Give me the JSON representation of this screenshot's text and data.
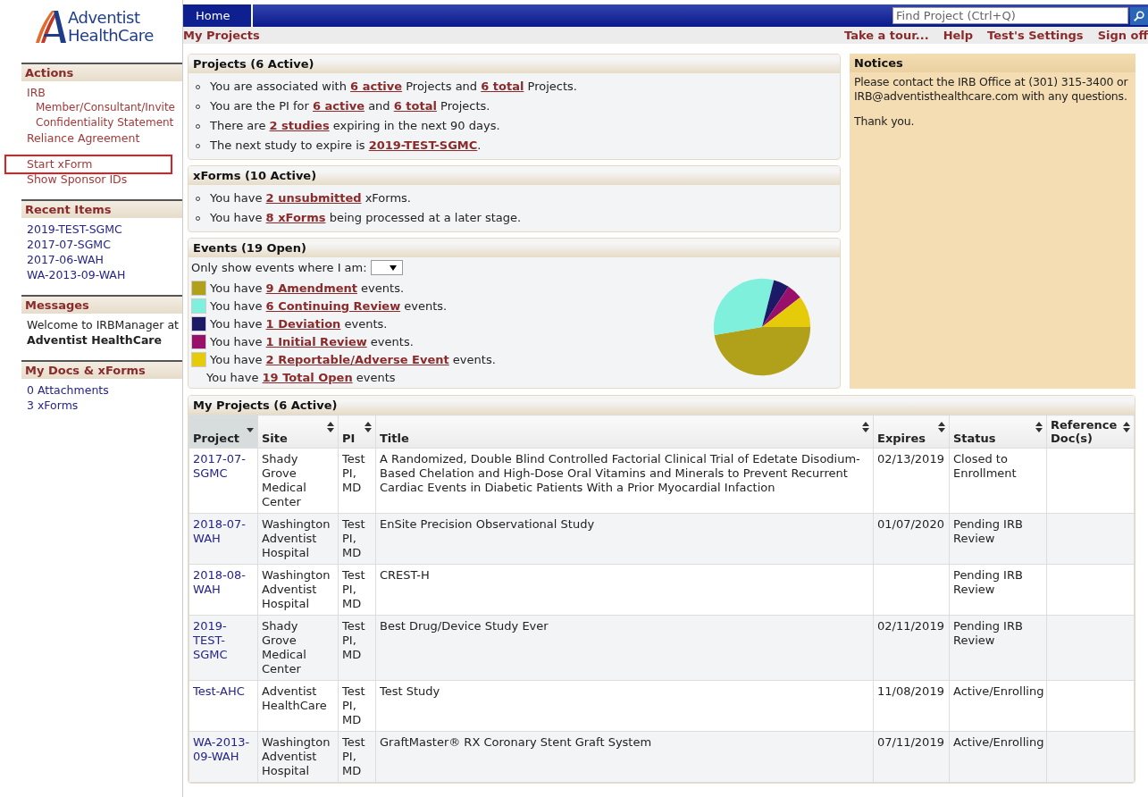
{
  "logo": {
    "line1": "Adventist",
    "line2": "HealthCare"
  },
  "top_bar": {
    "tabs": [
      {
        "label": "Home",
        "selected": true
      }
    ],
    "search": {
      "placeholder": "Find Project (Ctrl+Q)"
    }
  },
  "sub_bar": {
    "title": "My Projects",
    "links": [
      "Take a tour...",
      "Help",
      "Test's Settings",
      "Sign off"
    ]
  },
  "sidebar": [
    {
      "title": "Actions",
      "groups": [
        [
          {
            "kind": "action",
            "text": "IRB",
            "highlighted": false,
            "children": [
              {
                "text": "Member/Consultant/Invite Confidentiality Statement"
              }
            ]
          },
          {
            "kind": "action",
            "text": "Reliance Agreement",
            "highlighted": false
          }
        ],
        [
          {
            "kind": "action",
            "text": "Start xForm",
            "highlighted": true
          },
          {
            "kind": "action",
            "text": "Show Sponsor IDs",
            "highlighted": false
          }
        ]
      ]
    },
    {
      "title": "Recent Items",
      "groups": [
        [
          {
            "kind": "recent",
            "text": "2019-TEST-SGMC"
          },
          {
            "kind": "recent",
            "text": "2017-07-SGMC"
          },
          {
            "kind": "recent",
            "text": "2017-06-WAH"
          },
          {
            "kind": "recent",
            "text": "WA-2013-09-WAH"
          }
        ]
      ]
    },
    {
      "title": "Messages",
      "groups": [
        [
          {
            "kind": "message",
            "text": "Welcome to IRBManager at **Adventist HealthCare**"
          }
        ]
      ]
    },
    {
      "title": "My Docs & xForms",
      "groups": [
        [
          {
            "kind": "recent",
            "text": "0 Attachments"
          },
          {
            "kind": "recent",
            "text": "3 xForms"
          }
        ]
      ]
    }
  ],
  "projects": {
    "title": "Projects (6 Active)",
    "lines": [
      [
        {
          "kind": "text",
          "text": "You are associated with "
        },
        {
          "kind": "link",
          "text": "6 active"
        },
        {
          "kind": "text",
          "text": " Projects and "
        },
        {
          "kind": "link",
          "text": "6 total"
        },
        {
          "kind": "text",
          "text": " Projects."
        }
      ],
      [
        {
          "kind": "text",
          "text": "You are the PI for "
        },
        {
          "kind": "link",
          "text": "6 active"
        },
        {
          "kind": "text",
          "text": " and "
        },
        {
          "kind": "link",
          "text": "6 total"
        },
        {
          "kind": "text",
          "text": " Projects."
        }
      ],
      [
        {
          "kind": "text",
          "text": "There are "
        },
        {
          "kind": "link",
          "text": "2 studies"
        },
        {
          "kind": "text",
          "text": " expiring in the next 90 days."
        }
      ],
      [
        {
          "kind": "text",
          "text": "The next study to expire is "
        },
        {
          "kind": "link",
          "text": "2019-TEST-SGMC"
        },
        {
          "kind": "text",
          "text": "."
        }
      ]
    ]
  },
  "xforms": {
    "title": "xForms (10 Active)",
    "lines": [
      [
        {
          "kind": "text",
          "text": "You have "
        },
        {
          "kind": "link",
          "text": "2 unsubmitted"
        },
        {
          "kind": "text",
          "text": " xForms."
        }
      ],
      [
        {
          "kind": "text",
          "text": "You have "
        },
        {
          "kind": "link",
          "text": "8 xForms"
        },
        {
          "kind": "text",
          "text": " being processed at a later stage."
        }
      ]
    ]
  },
  "events": {
    "title": "Events (19 Open)",
    "filter_label": "Only show events where I am:",
    "items": [
      {
        "color": "#b1a11a",
        "parts": [
          {
            "kind": "text",
            "text": "You have "
          },
          {
            "kind": "link",
            "text": "9 Amendment"
          },
          {
            "kind": "text",
            "text": " events."
          }
        ]
      },
      {
        "color": "#7ff0dc",
        "parts": [
          {
            "kind": "text",
            "text": "You have "
          },
          {
            "kind": "link",
            "text": "6 Continuing Review"
          },
          {
            "kind": "text",
            "text": " events."
          }
        ]
      },
      {
        "color": "#1c1a66",
        "parts": [
          {
            "kind": "text",
            "text": "You have "
          },
          {
            "kind": "link",
            "text": "1 Deviation"
          },
          {
            "kind": "text",
            "text": " events."
          }
        ]
      },
      {
        "color": "#99106a",
        "parts": [
          {
            "kind": "text",
            "text": "You have "
          },
          {
            "kind": "link",
            "text": "1 Initial Review"
          },
          {
            "kind": "text",
            "text": " events."
          }
        ]
      },
      {
        "color": "#e6cb0a",
        "parts": [
          {
            "kind": "text",
            "text": "You have "
          },
          {
            "kind": "link",
            "text": "2 Reportable/Adverse Event"
          },
          {
            "kind": "text",
            "text": " events."
          }
        ]
      }
    ],
    "total": [
      {
        "kind": "text",
        "text": "You have "
      },
      {
        "kind": "link",
        "text": "19 Total Open"
      },
      {
        "kind": "text",
        "text": " events"
      }
    ],
    "chart_data": {
      "type": "pie",
      "values": [
        47.37,
        31.58,
        5.26,
        5.26,
        10.53
      ]
    }
  },
  "notices": {
    "title": "Notices",
    "paragraphs": [
      "Please contact the IRB Office at (301) 315-3400 or IRB@adventisthealthcare.com with any questions.",
      "Thank you."
    ]
  },
  "table": {
    "title": "My Projects (6 Active)",
    "columns": [
      {
        "label": "Project",
        "sorted": true
      },
      {
        "label": "Site",
        "sorted": false
      },
      {
        "label": "PI",
        "sorted": false
      },
      {
        "label": "Title",
        "sorted": false
      },
      {
        "label": "Expires",
        "sorted": false
      },
      {
        "label": "Status",
        "sorted": false
      },
      {
        "label": "Reference Doc(s)",
        "sorted": false
      }
    ],
    "rows": [
      [
        "2017-07-SGMC",
        "Shady Grove Medical Center",
        "Test PI, MD",
        "A Randomized, Double Blind Controlled Factorial Clinical Trial of Edetate Disodium-Based Chelation and High-Dose Oral Vitamins and Minerals to Prevent Recurrent Cardiac Events in Diabetic Patients With a Prior Myocardial Infaction",
        "02/13/2019",
        "Closed to Enrollment",
        ""
      ],
      [
        "2018-07-WAH",
        "Washington Adventist Hospital",
        "Test PI, MD",
        "EnSite Precision Observational Study",
        "01/07/2020",
        "Pending IRB Review",
        ""
      ],
      [
        "2018-08-WAH",
        "Washington Adventist Hospital",
        "Test PI, MD",
        "CREST-H",
        "",
        "Pending IRB Review",
        ""
      ],
      [
        "2019-TEST-SGMC",
        "Shady Grove Medical Center",
        "Test PI, MD",
        "Best Drug/Device Study Ever",
        "02/11/2019",
        "Pending IRB Review",
        ""
      ],
      [
        "Test-AHC",
        "Adventist HealthCare",
        "Test PI, MD",
        "Test Study",
        "11/08/2019",
        "Active/Enrolling",
        ""
      ],
      [
        "WA-2013-09-WAH",
        "Washington Adventist Hospital",
        "Test PI, MD",
        "GraftMaster® RX Coronary Stent Graft System",
        "07/11/2019",
        "Active/Enrolling",
        ""
      ]
    ]
  }
}
